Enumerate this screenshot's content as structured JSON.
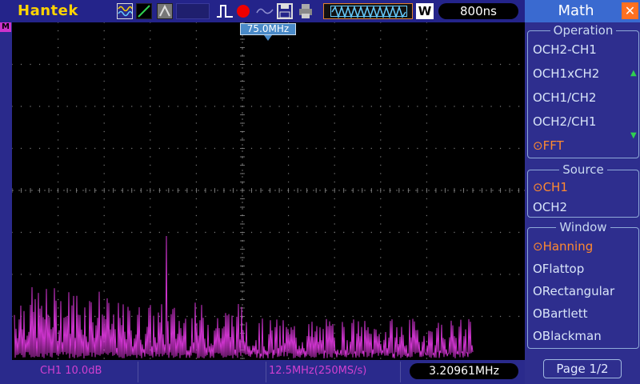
{
  "brand": "Hantek",
  "toolbar": {
    "timebase": "800ns",
    "window_badge": "W"
  },
  "display": {
    "math_marker": "M",
    "freq_marker": "75.0MHz",
    "trace_color": "#cc33cc",
    "grid_divisions": {
      "x": 10,
      "y": 8
    }
  },
  "status": {
    "ch1_scale": "CH1 10.0dB",
    "sample_rate": "12.5MHz(250MS/s)",
    "cursor_freq": "3.20961MHz"
  },
  "menu": {
    "title": "Math",
    "close_icon": "close-icon",
    "operation": {
      "label": "Operation",
      "options": [
        "CH2-CH1",
        "CH1xCH2",
        "CH1/CH2",
        "CH2/CH1",
        "FFT"
      ],
      "selected": "FFT"
    },
    "source": {
      "label": "Source",
      "options": [
        "CH1",
        "CH2"
      ],
      "selected": "CH1"
    },
    "window": {
      "label": "Window",
      "options": [
        "Hanning",
        "Flattop",
        "Rectangular",
        "Bartlett",
        "Blackman"
      ],
      "selected": "Hanning"
    },
    "page": "Page 1/2"
  },
  "colors": {
    "accent_selected": "#ff8a30",
    "brand": "#ffd400",
    "background": "#2a2a8c"
  }
}
